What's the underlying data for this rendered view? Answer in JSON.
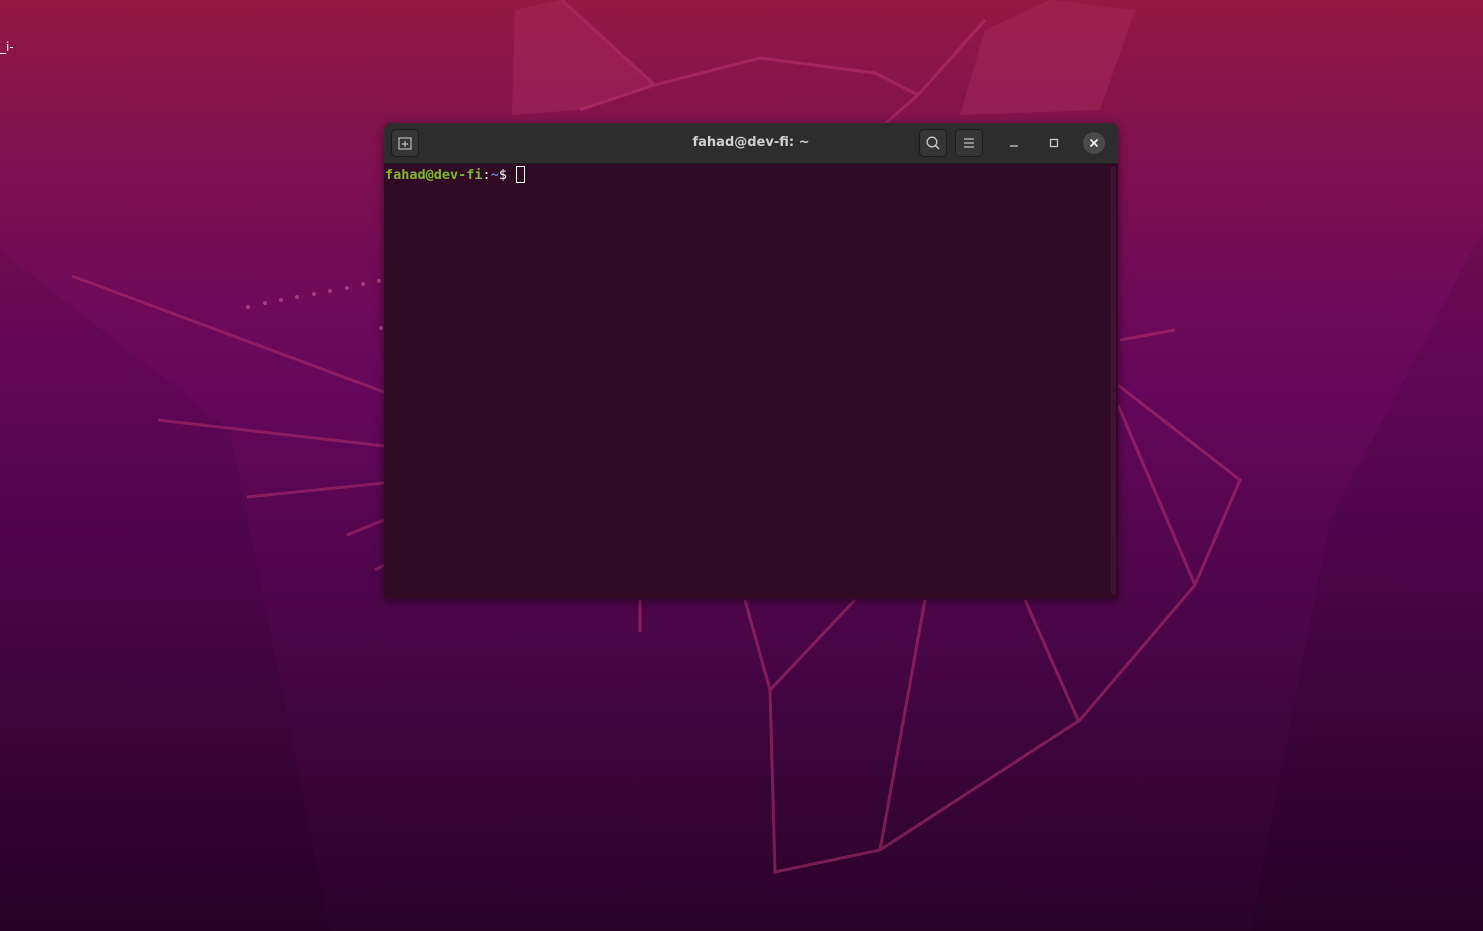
{
  "desktop": {
    "corner_label": "_i-"
  },
  "window": {
    "title": "fahad@dev-fi: ~",
    "buttons": {
      "new_tab_icon": "new-tab-icon",
      "search_icon": "search-icon",
      "menu_icon": "hamburger-menu-icon",
      "minimize_icon": "minimize-icon",
      "maximize_icon": "maximize-icon",
      "close_icon": "close-icon"
    }
  },
  "terminal": {
    "prompt_user_host": "fahad@dev-fi",
    "prompt_colon": ":",
    "prompt_path": "~",
    "prompt_symbol": "$ ",
    "background_color": "#300a24",
    "user_color": "#7fb926",
    "path_color": "#5a86c9"
  }
}
